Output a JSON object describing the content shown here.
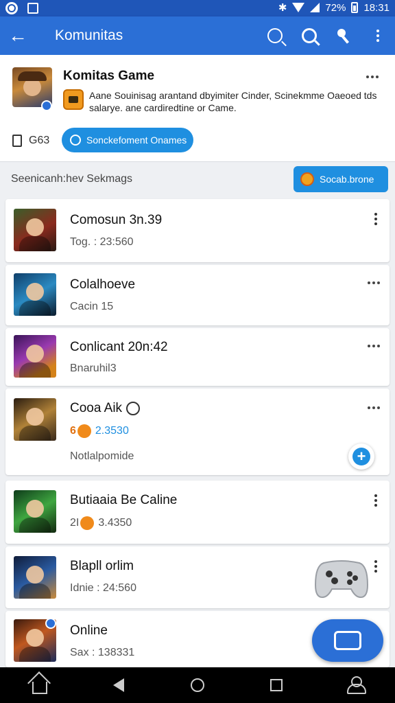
{
  "status_bar": {
    "battery": "72%",
    "time": "18:31"
  },
  "app_bar": {
    "title": "Komunitas",
    "icons": [
      "back-arrow-icon",
      "search-outline-icon",
      "search-icon",
      "wrench-icon",
      "more-vert-icon"
    ]
  },
  "group": {
    "name": "Komitas Game",
    "description": "Aane Souinisag arantand dbyimiter Cinder, Scinekmme Oaeoed tds salarye. ane cardiredtine or Came.",
    "members": "G63",
    "search_button": "Sonckefoment Onames"
  },
  "section": {
    "label": "Seenicanh:hev Sekmags",
    "social_button": "Socab.brone"
  },
  "items": [
    {
      "title": "Comosun 3n.39",
      "subtitle": "Tog. : 23:560"
    },
    {
      "title": "Colalhoeve",
      "subtitle": "Cacin 15"
    },
    {
      "title": "Conlicant 20n:42",
      "subtitle": "Bnaruhil3"
    },
    {
      "title": "Cooa Aik",
      "count": "6",
      "score": "2.3530",
      "subtitle": "Notlalpomide"
    },
    {
      "title": "Butiaaia Be Caline",
      "count": "2I",
      "score": "3.4350"
    },
    {
      "title": "Blapll orlim",
      "subtitle": "Idnie : 24:560"
    },
    {
      "title": "Online",
      "subtitle": "Sax : 138331"
    }
  ],
  "colors": {
    "primary": "#2b6fd6",
    "accent": "#1f8fe0",
    "orange": "#f08a1a"
  }
}
